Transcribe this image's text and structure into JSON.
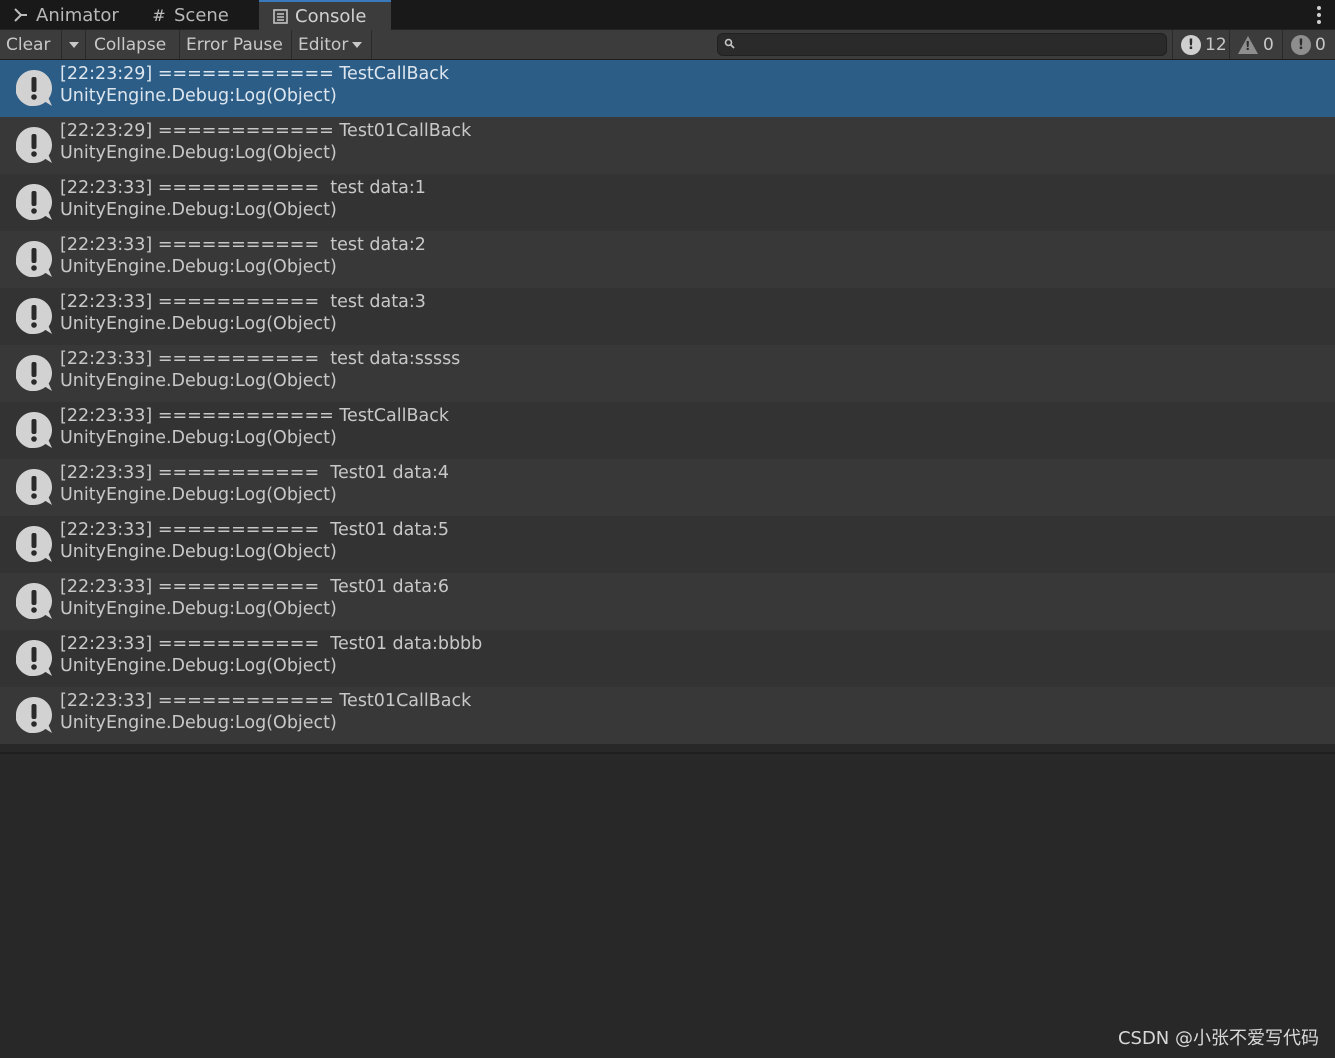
{
  "tabs": [
    {
      "label": "Animator",
      "icon": "animator-icon"
    },
    {
      "label": "Scene",
      "icon": "hash-icon"
    },
    {
      "label": "Console",
      "icon": "console-icon"
    }
  ],
  "toolbar": {
    "clear_label": "Clear",
    "collapse_label": "Collapse",
    "error_pause_label": "Error Pause",
    "editor_label": "Editor",
    "search_value": "",
    "log_count": "12",
    "warning_count": "0",
    "error_count": "0"
  },
  "logs": [
    {
      "line1": "[22:23:29] ============ TestCallBack",
      "line2": "UnityEngine.Debug:Log(Object)"
    },
    {
      "line1": "[22:23:29] ============ Test01CallBack",
      "line2": "UnityEngine.Debug:Log(Object)"
    },
    {
      "line1": "[22:23:33] ===========  test data:1",
      "line2": "UnityEngine.Debug:Log(Object)"
    },
    {
      "line1": "[22:23:33] ===========  test data:2",
      "line2": "UnityEngine.Debug:Log(Object)"
    },
    {
      "line1": "[22:23:33] ===========  test data:3",
      "line2": "UnityEngine.Debug:Log(Object)"
    },
    {
      "line1": "[22:23:33] ===========  test data:sssss",
      "line2": "UnityEngine.Debug:Log(Object)"
    },
    {
      "line1": "[22:23:33] ============ TestCallBack",
      "line2": "UnityEngine.Debug:Log(Object)"
    },
    {
      "line1": "[22:23:33] ===========  Test01 data:4",
      "line2": "UnityEngine.Debug:Log(Object)"
    },
    {
      "line1": "[22:23:33] ===========  Test01 data:5",
      "line2": "UnityEngine.Debug:Log(Object)"
    },
    {
      "line1": "[22:23:33] ===========  Test01 data:6",
      "line2": "UnityEngine.Debug:Log(Object)"
    },
    {
      "line1": "[22:23:33] ===========  Test01 data:bbbb",
      "line2": "UnityEngine.Debug:Log(Object)"
    },
    {
      "line1": "[22:23:33] ============ Test01CallBack",
      "line2": "UnityEngine.Debug:Log(Object)"
    }
  ],
  "watermark": "CSDN @小张不爱写代码",
  "colors": {
    "selected_row": "#2c5d87",
    "active_tab_accent": "#3a79bb"
  }
}
